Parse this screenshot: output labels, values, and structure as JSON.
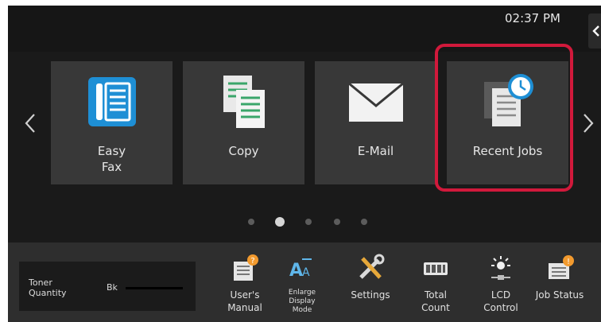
{
  "status": {
    "time": "02:37 PM"
  },
  "tiles": [
    {
      "label_lines": [
        "Easy",
        "Fax"
      ]
    },
    {
      "label_lines": [
        "Copy"
      ]
    },
    {
      "label_lines": [
        "E-Mail"
      ]
    },
    {
      "label_lines": [
        "Recent Jobs"
      ],
      "highlighted": true
    }
  ],
  "pager": {
    "count": 5,
    "active": 2
  },
  "toner": {
    "label_lines": [
      "Toner",
      "Quantity"
    ],
    "color_label": "Bk",
    "level": "full"
  },
  "bottom_buttons": [
    {
      "label_lines": [
        "User's",
        "Manual"
      ],
      "icon": "manual-icon"
    },
    {
      "label_lines": [
        "Enlarge",
        "Display",
        "Mode"
      ],
      "icon": "enlarge-text-icon"
    },
    {
      "label_lines": [
        "Settings"
      ],
      "icon": "settings-tools-icon"
    },
    {
      "label_lines": [
        "Total",
        "Count"
      ],
      "icon": "counter-icon"
    },
    {
      "label_lines": [
        "LCD",
        "Control"
      ],
      "icon": "brightness-icon"
    },
    {
      "label_lines": [
        "Job Status"
      ],
      "icon": "job-status-icon"
    }
  ],
  "colors": {
    "highlight": "#d1193b",
    "fax_blue": "#1e8fd5",
    "doc_green": "#3aa66a",
    "notice_orange": "#f29a2e"
  }
}
